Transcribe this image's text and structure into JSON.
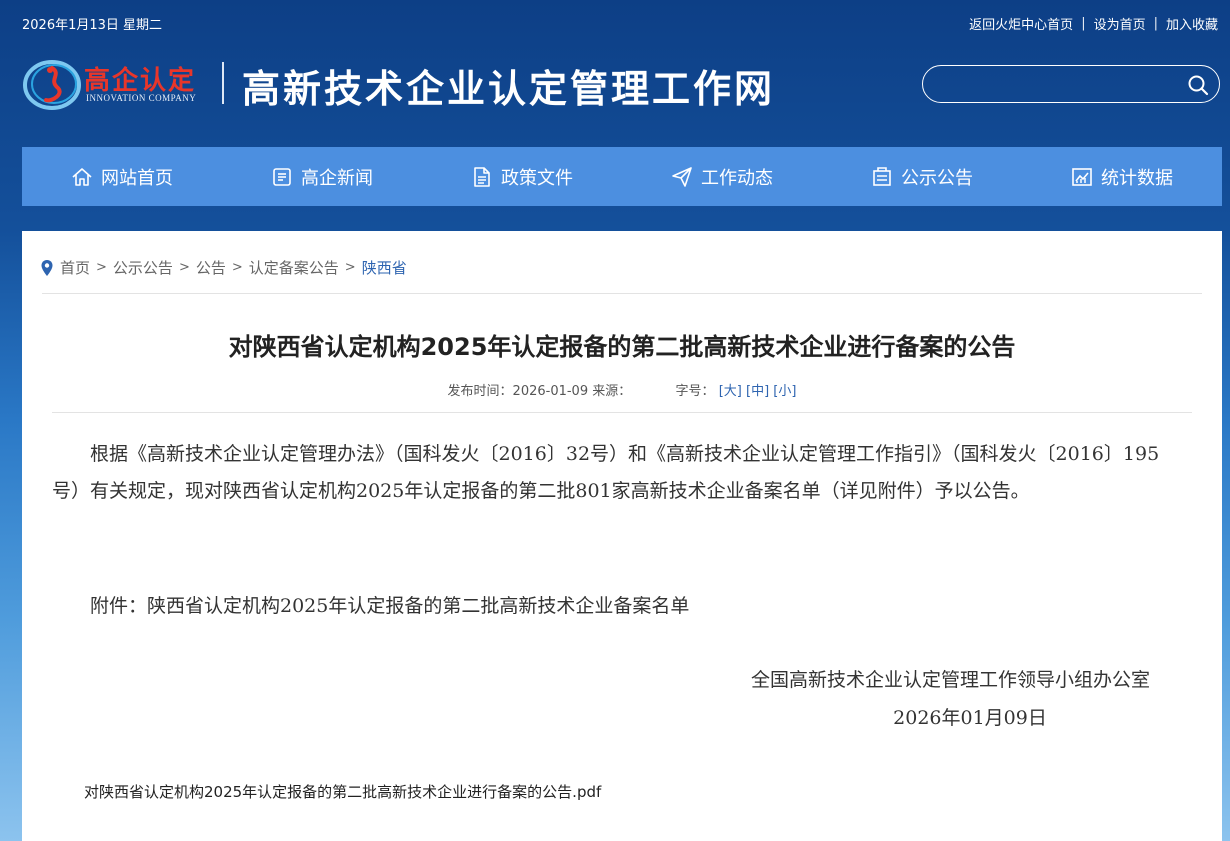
{
  "topbar": {
    "date": "2026年1月13日 星期二",
    "links": [
      "返回火炬中心首页",
      "设为首页",
      "加入收藏"
    ],
    "sep": "|"
  },
  "brand": {
    "logo_cn": "高企认定",
    "logo_en": "INNOVATION COMPANY",
    "site_title": "高新技术企业认定管理工作网"
  },
  "search": {
    "placeholder": "",
    "icon": "search-icon"
  },
  "nav": [
    {
      "label": "网站首页",
      "icon": "home-icon"
    },
    {
      "label": "高企新闻",
      "icon": "news-icon"
    },
    {
      "label": "政策文件",
      "icon": "document-icon"
    },
    {
      "label": "工作动态",
      "icon": "paper-plane-icon"
    },
    {
      "label": "公示公告",
      "icon": "notice-icon"
    },
    {
      "label": "统计数据",
      "icon": "chart-icon"
    }
  ],
  "breadcrumb": {
    "items": [
      "首页",
      "公示公告",
      "公告",
      "认定备案公告"
    ],
    "current": "陕西省",
    "sep": ">"
  },
  "article": {
    "title": "对陕西省认定机构2025年认定报备的第二批高新技术企业进行备案的公告",
    "publish_label": "发布时间：",
    "publish_date": "2026-01-09",
    "source_label": "来源：",
    "font_size_label": "字号：",
    "font_sizes": [
      "[大]",
      "[中]",
      "[小]"
    ],
    "paragraph1": "根据《高新技术企业认定管理办法》（国科发火〔2016〕32号）和《高新技术企业认定管理工作指引》（国科发火〔2016〕195号）有关规定，现对陕西省认定机构2025年认定报备的第二批801家高新技术企业备案名单（详见附件）予以公告。",
    "paragraph2": "附件：陕西省认定机构2025年认定报备的第二批高新技术企业备案名单",
    "sign_org": "全国高新技术企业认定管理工作领导小组办公室",
    "sign_date": "2026年01月09日",
    "attachment": "对陕西省认定机构2025年认定报备的第二批高新技术企业进行备案的公告.pdf"
  },
  "colors": {
    "nav_bg": "#4c8fe0",
    "header_bg": "#0d3f86",
    "logo_red": "#e8362a",
    "link_blue": "#2e64b0"
  }
}
